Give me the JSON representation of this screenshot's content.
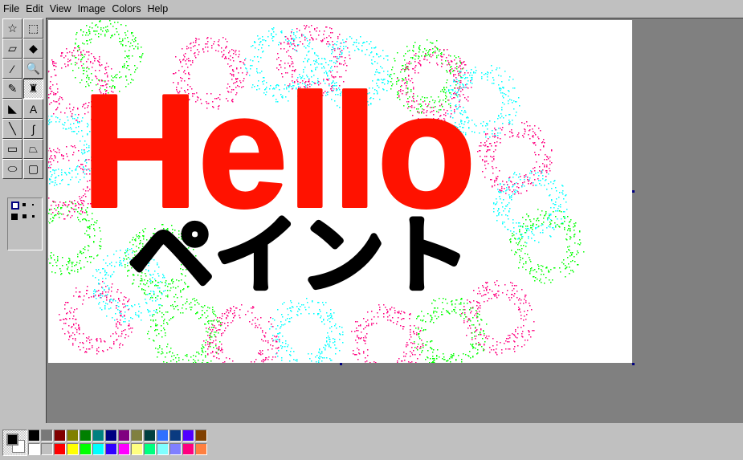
{
  "menu": [
    "File",
    "Edit",
    "View",
    "Image",
    "Colors",
    "Help"
  ],
  "tools": [
    {
      "name": "free-form-select",
      "glyph": "☆"
    },
    {
      "name": "select",
      "glyph": "⬚"
    },
    {
      "name": "eraser",
      "glyph": "▱"
    },
    {
      "name": "fill-with-color",
      "glyph": "◆"
    },
    {
      "name": "pick-color",
      "glyph": "⁄"
    },
    {
      "name": "magnifier",
      "glyph": "🔍"
    },
    {
      "name": "pencil",
      "glyph": "✎"
    },
    {
      "name": "brush",
      "glyph": "♜",
      "active": true
    },
    {
      "name": "airbrush",
      "glyph": "◣"
    },
    {
      "name": "text",
      "glyph": "A"
    },
    {
      "name": "line",
      "glyph": "╲"
    },
    {
      "name": "curve",
      "glyph": "∫"
    },
    {
      "name": "rectangle",
      "glyph": "▭"
    },
    {
      "name": "polygon",
      "glyph": "⏢"
    },
    {
      "name": "ellipse",
      "glyph": "⬭"
    },
    {
      "name": "rounded-rectangle",
      "glyph": "▢"
    }
  ],
  "canvas_text": {
    "line1": "Hello",
    "line2": "ペイント"
  },
  "colors": {
    "foreground": "#000000",
    "background": "#ffffff",
    "ink_red": "#ff1200",
    "ink_black": "#000000",
    "spray": [
      "#ff0080",
      "#00ff00",
      "#00ffff"
    ]
  },
  "palette": {
    "top": [
      "#000000",
      "#787878",
      "#800000",
      "#808000",
      "#008000",
      "#008080",
      "#000080",
      "#800080",
      "#808040",
      "#004040",
      "#3070ff",
      "#0a3a80",
      "#5000ff",
      "#804000"
    ],
    "bottom": [
      "#ffffff",
      "#c0c0c0",
      "#ff0000",
      "#ffff00",
      "#00ff00",
      "#00ffff",
      "#3000ff",
      "#ff00ff",
      "#ffff80",
      "#00ff80",
      "#80ffff",
      "#8080ff",
      "#ff0080",
      "#ff8040"
    ]
  }
}
